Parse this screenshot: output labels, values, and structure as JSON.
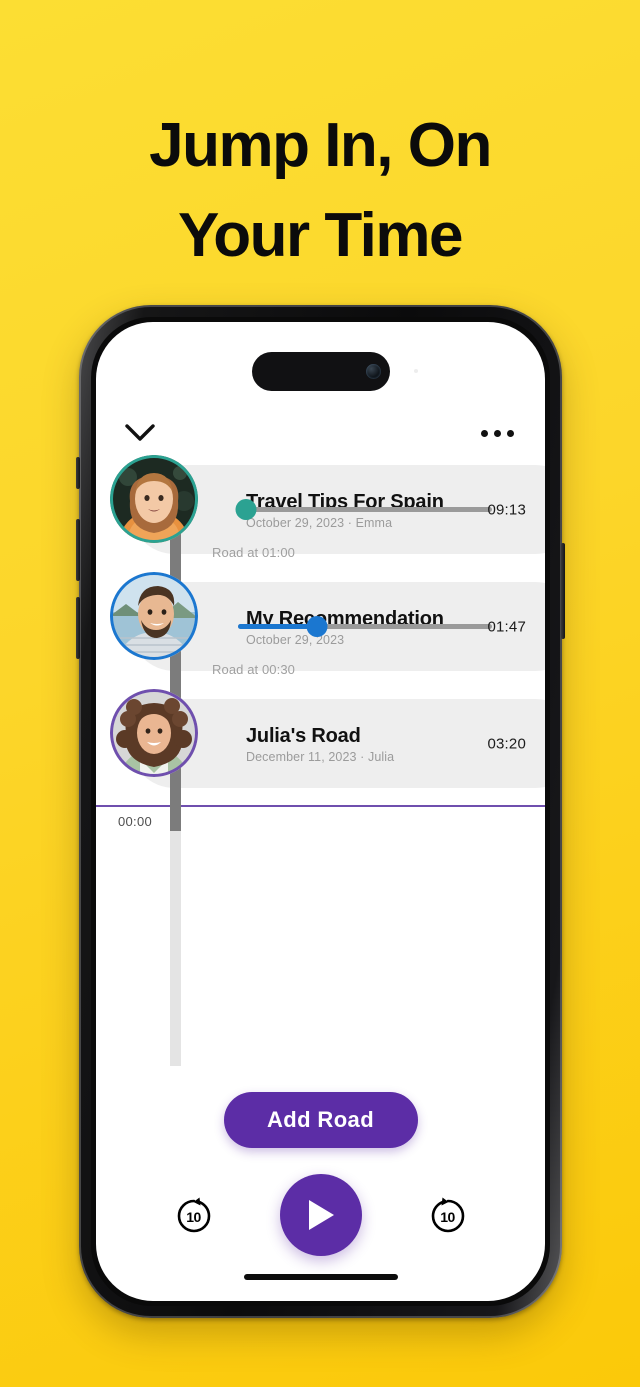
{
  "headline": {
    "line1": "Jump In, On",
    "line2": "Your Time"
  },
  "colors": {
    "background_top": "#FCDE33",
    "background_bottom": "#FBC909",
    "accent_purple": "#5C2DA6",
    "divider_purple": "#6F4FAE",
    "card_bg": "#EEEEEE",
    "rail_dark": "#7C7C7C",
    "rail_light": "#E4E4E4",
    "track_gray": "#9A9A9A"
  },
  "app": {
    "header": {
      "collapse_icon": "chevron-down-icon",
      "menu_icon": "more-horizontal-icon"
    },
    "timeline": {
      "zero_label": "00:00",
      "items": [
        {
          "title": "Travel Tips For Spain",
          "meta": "October 29, 2023  ·  Emma",
          "duration": "09:13",
          "ring_color": "#2BA292",
          "knob_color": "#2BA292",
          "progress_percent": 3,
          "has_progress": true,
          "caption_below": "Road at 01:00"
        },
        {
          "title": "My Recommendation",
          "meta": "October 29, 2023",
          "duration": "01:47",
          "ring_color": "#1B77D0",
          "knob_color": "#1B77D0",
          "progress_percent": 31,
          "has_progress": true,
          "caption_below": "Road at 00:30"
        },
        {
          "title": "Julia's Road",
          "meta": "December 11, 2023  ·  Julia",
          "duration": "03:20",
          "ring_color": "#6F4FAE",
          "knob_color": "#6F4FAE",
          "progress_percent": 0,
          "has_progress": false,
          "caption_below": ""
        }
      ]
    },
    "actions": {
      "add_road_label": "Add Road",
      "rewind_label": "10",
      "forward_label": "10",
      "rewind_icon": "rewind-10-icon",
      "forward_icon": "forward-10-icon",
      "play_icon": "play-icon"
    }
  }
}
